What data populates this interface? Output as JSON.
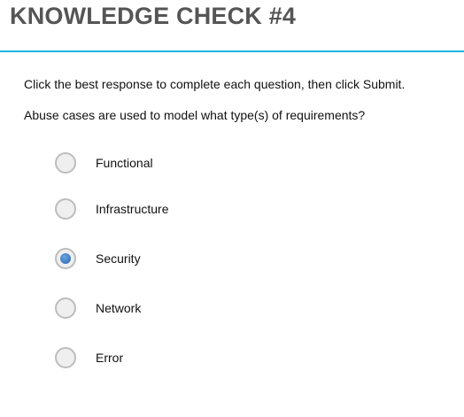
{
  "header": {
    "title": "KNOWLEDGE CHECK #4"
  },
  "instructions": "Click the best response to complete each question, then click Submit.",
  "question": "Abuse cases are used to model what type(s) of requirements?",
  "options": [
    {
      "label": "Functional",
      "selected": false
    },
    {
      "label": "Infrastructure",
      "selected": false
    },
    {
      "label": "Security",
      "selected": true
    },
    {
      "label": "Network",
      "selected": false
    },
    {
      "label": "Error",
      "selected": false
    }
  ],
  "colors": {
    "accent": "#22b5e2",
    "title": "#555555",
    "radio_selected": "#2a62b0"
  }
}
